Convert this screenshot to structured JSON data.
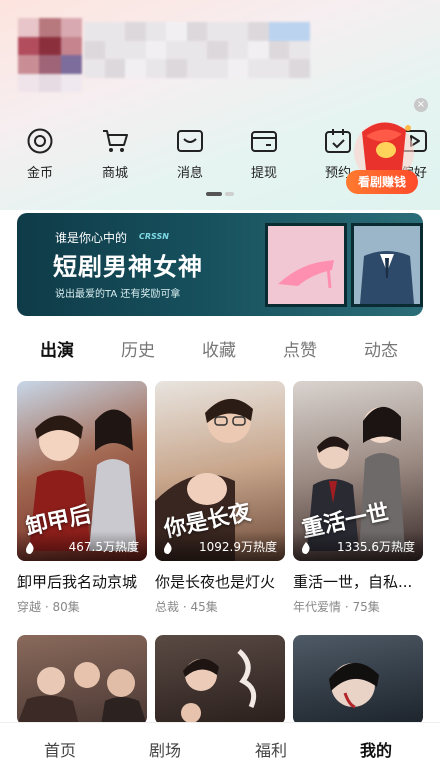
{
  "quick": {
    "items": [
      {
        "label": "金币",
        "icon": "coin-icon"
      },
      {
        "label": "商城",
        "icon": "cart-icon"
      },
      {
        "label": "消息",
        "icon": "message-icon"
      },
      {
        "label": "提现",
        "icon": "wallet-icon"
      },
      {
        "label": "预约",
        "icon": "calendar-icon"
      },
      {
        "label": "偏好",
        "icon": "play-icon"
      }
    ]
  },
  "float_promo": {
    "label": "看剧赚钱",
    "close": "×"
  },
  "banner": {
    "line1": "谁是你心中的",
    "brand": "CRSSN",
    "title": "短剧男神女神",
    "line2": "说出最爱的TA 还有奖励可拿"
  },
  "tabs": [
    "出演",
    "历史",
    "收藏",
    "点赞",
    "动态"
  ],
  "cards": [
    {
      "title": "卸甲后我名动京城",
      "meta": "穿越 · 80集",
      "heat": "467.5万热度",
      "art": "卸甲后"
    },
    {
      "title": "你是长夜也是灯火",
      "meta": "总裁 · 45集",
      "heat": "1092.9万热度",
      "art": "你是长夜"
    },
    {
      "title": "重活一世，自私...",
      "meta": "年代爱情 · 75集",
      "heat": "1335.6万热度",
      "art": "重活一世"
    }
  ],
  "nav": [
    "首页",
    "剧场",
    "福利",
    "我的"
  ],
  "colors": {
    "accent": "#ff5a2b",
    "banner_bg": "#17505d"
  }
}
